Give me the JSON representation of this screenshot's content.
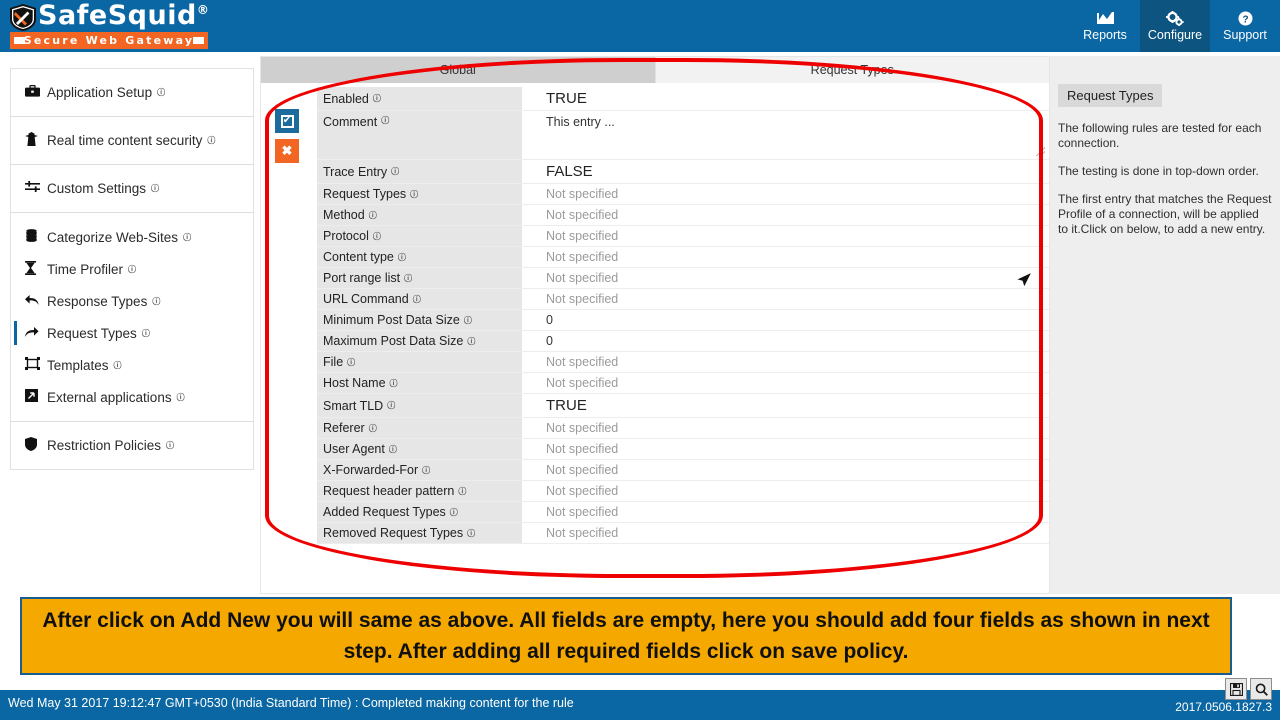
{
  "header": {
    "logo_name": "SafeSquid",
    "logo_reg": "®",
    "logo_tagline": "Secure Web Gateway",
    "nav": [
      {
        "label": "Reports",
        "icon": "chart-icon",
        "glyph": "Ὄ8",
        "active": false
      },
      {
        "label": "Configure",
        "icon": "gears-icon",
        "glyph": "⚙",
        "active": true
      },
      {
        "label": "Support",
        "icon": "help-circle-icon",
        "glyph": "❓",
        "active": false
      }
    ]
  },
  "sidebar": {
    "groups": [
      {
        "items": [
          {
            "label": "Application Setup",
            "icon": "briefcase-icon",
            "glyph": "ὋC",
            "info": true,
            "selected": false
          }
        ]
      },
      {
        "items": [
          {
            "label": "Real time content security",
            "icon": "shield-person-icon",
            "glyph": "♟",
            "info": true,
            "selected": false
          }
        ]
      },
      {
        "items": [
          {
            "label": "Custom Settings",
            "icon": "sliders-icon",
            "glyph": "≡",
            "info": true,
            "selected": false
          }
        ]
      },
      {
        "items": [
          {
            "label": "Categorize Web-Sites",
            "icon": "database-icon",
            "glyph": "▤",
            "info": true,
            "selected": false
          },
          {
            "label": "Time Profiler",
            "icon": "hourglass-icon",
            "glyph": "⧖",
            "info": true,
            "selected": false
          },
          {
            "label": "Response Types",
            "icon": "arrow-back-icon",
            "glyph": "↶",
            "info": true,
            "selected": false
          },
          {
            "label": "Request Types",
            "icon": "arrow-forward-icon",
            "glyph": "↷",
            "info": true,
            "selected": true
          },
          {
            "label": "Templates",
            "icon": "template-icon",
            "glyph": "❐",
            "info": true,
            "selected": false
          },
          {
            "label": "External applications",
            "icon": "external-app-icon",
            "glyph": "↗",
            "info": true,
            "selected": false
          }
        ]
      },
      {
        "items": [
          {
            "label": "Restriction Policies",
            "icon": "shield-icon",
            "glyph": "⛨",
            "info": true,
            "selected": false
          }
        ]
      }
    ]
  },
  "main": {
    "tabs": [
      {
        "label": "Global",
        "active": true
      },
      {
        "label": "Request Types",
        "active": false
      }
    ],
    "gutter": {
      "enable_toggle_icon": "checkbox-checked-icon",
      "enable_toggle_glyph": "✔",
      "delete_icon": "close-x-icon",
      "delete_glyph": "✖"
    },
    "fields": [
      {
        "label": "Enabled",
        "value": "TRUE",
        "style": "big",
        "size": "md"
      },
      {
        "label": "Comment",
        "value": "This entry ...",
        "style": "plain",
        "size": "tall"
      },
      {
        "label": "Trace Entry",
        "value": "FALSE",
        "style": "big",
        "size": "md"
      },
      {
        "label": "Request Types",
        "value": "Not specified",
        "style": "muted",
        "size": "sm"
      },
      {
        "label": "Method",
        "value": "Not specified",
        "style": "muted",
        "size": "sm"
      },
      {
        "label": "Protocol",
        "value": "Not specified",
        "style": "muted",
        "size": "sm"
      },
      {
        "label": "Content type",
        "value": "Not specified",
        "style": "muted",
        "size": "sm"
      },
      {
        "label": "Port range list",
        "value": "Not specified",
        "style": "muted",
        "size": "sm"
      },
      {
        "label": "URL Command",
        "value": "Not specified",
        "style": "muted",
        "size": "sm"
      },
      {
        "label": "Minimum Post Data Size",
        "value": "0",
        "style": "plain",
        "size": "sm"
      },
      {
        "label": "Maximum Post Data Size",
        "value": "0",
        "style": "plain",
        "size": "sm"
      },
      {
        "label": "File",
        "value": "Not specified",
        "style": "muted",
        "size": "sm"
      },
      {
        "label": "Host Name",
        "value": "Not specified",
        "style": "muted",
        "size": "sm"
      },
      {
        "label": "Smart TLD",
        "value": "TRUE",
        "style": "big",
        "size": "md"
      },
      {
        "label": "Referer",
        "value": "Not specified",
        "style": "muted",
        "size": "sm"
      },
      {
        "label": "User Agent",
        "value": "Not specified",
        "style": "muted",
        "size": "sm"
      },
      {
        "label": "X-Forwarded-For",
        "value": "Not specified",
        "style": "muted",
        "size": "sm"
      },
      {
        "label": "Request header pattern",
        "value": "Not specified",
        "style": "muted",
        "size": "sm"
      },
      {
        "label": "Added Request Types",
        "value": "Not specified",
        "style": "muted",
        "size": "sm"
      },
      {
        "label": "Removed Request Types",
        "value": "Not specified",
        "style": "muted",
        "size": "sm"
      }
    ]
  },
  "help": {
    "title": "Request Types",
    "paragraphs": [
      "The following rules are tested for each connection.",
      "The testing is done in top-down order.",
      "The first entry that matches the Request Profile of a connection, will be applied to it.Click on below, to add a new entry."
    ]
  },
  "caption": {
    "text": "After click on Add New you will same as above. All fields are empty, here you should add four fields as shown in next step. After adding all required fields click on save policy."
  },
  "statusbar": {
    "message": "Wed May 31 2017 19:12:47 GMT+0530 (India Standard Time) : Completed making content for the rule",
    "version": "2017.0506.1827.3",
    "icons": [
      {
        "name": "save-icon",
        "glyph": "ὋE"
      },
      {
        "name": "search-icon",
        "glyph": "ὐD"
      }
    ]
  },
  "colors": {
    "brand_blue": "#0a67a3",
    "accent_orange": "#f26522",
    "annotation_red": "#ee0000",
    "caption_yellow": "#f5a800"
  }
}
